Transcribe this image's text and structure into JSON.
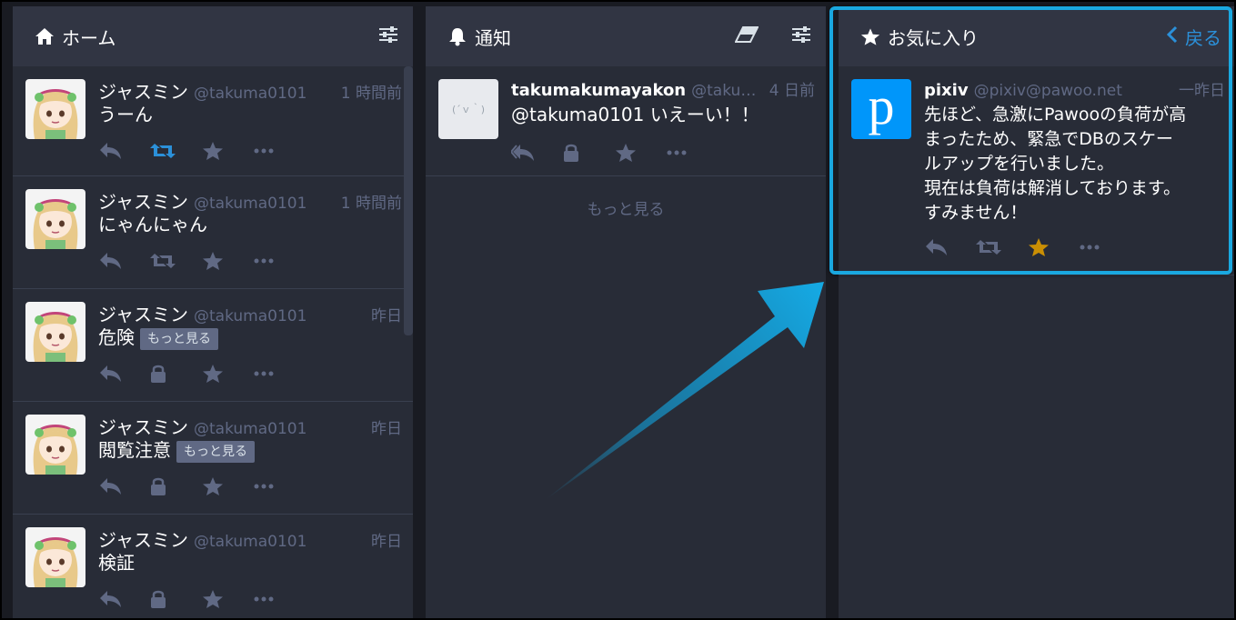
{
  "home": {
    "title": "ホーム",
    "icons": [
      "home-icon",
      "settings-sliders-icon"
    ],
    "statuses": [
      {
        "display_name": "ジャスミン",
        "acct": "@takuma0101",
        "time": "1 時間前",
        "content": "うーん",
        "more": "",
        "boosted": true
      },
      {
        "display_name": "ジャスミン",
        "acct": "@takuma0101",
        "time": "1 時間前",
        "content": "にゃんにゃん",
        "more": "",
        "boosted": false
      },
      {
        "display_name": "ジャスミン",
        "acct": "@takuma0101",
        "time": "昨日",
        "content": "危険",
        "more": "もっと見る",
        "locked": true
      },
      {
        "display_name": "ジャスミン",
        "acct": "@takuma0101",
        "time": "昨日",
        "content": "閲覧注意",
        "more": "もっと見る",
        "locked": true
      },
      {
        "display_name": "ジャスミン",
        "acct": "@takuma0101",
        "time": "昨日",
        "content": "検証",
        "more": "",
        "locked": true
      }
    ]
  },
  "notifications": {
    "title": "通知",
    "icons": [
      "bell-icon",
      "eraser-icon",
      "settings-sliders-icon"
    ],
    "statuses": [
      {
        "display_name": "takumakumayakon",
        "acct": "@takum…",
        "time": "4 日前",
        "content": "@takuma0101 いえーい！！",
        "avatar_text": "(´ｖ｀)"
      }
    ],
    "load_more": "もっと見る"
  },
  "favourites": {
    "title": "お気に入り",
    "back_label": "戻る",
    "icons": [
      "star-icon",
      "chevron-left-icon"
    ],
    "status": {
      "display_name": "pixiv",
      "acct": "@pixiv@pawoo.net",
      "time": "一昨日",
      "content_lines": [
        "先ほど、急激にPawooの負荷が高",
        "まったため、緊急でDBのスケー",
        "ルアップを行いました。",
        "現在は負荷は解消しております。",
        "すみません！"
      ],
      "avatar_letter": "p"
    }
  },
  "colors": {
    "accent": "#2b90d9",
    "favourite": "#ca8f04",
    "highlight": "#1aa8e0",
    "muted": "#606984"
  }
}
